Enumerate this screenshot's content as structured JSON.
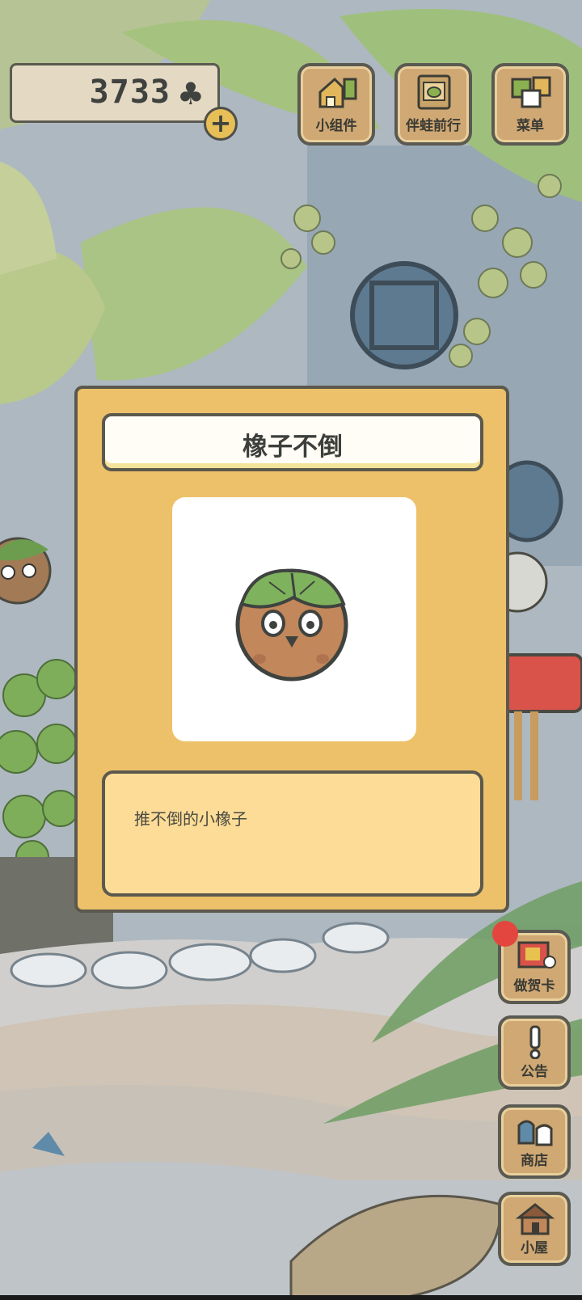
{
  "currency": {
    "count": "3733",
    "icon": "clover-icon",
    "add_icon": "plus-icon"
  },
  "top_buttons": {
    "widgets": {
      "label": "小组件",
      "icon": "widget-house-icon"
    },
    "frog_progress": {
      "label": "伴蛙前行",
      "icon": "frog-book-icon"
    },
    "menu": {
      "label": "菜单",
      "icon": "menu-cards-icon"
    }
  },
  "dialog": {
    "title": "橡子不倒",
    "item_icon": "acorn-owl-icon",
    "description": "推不倒的小橡子"
  },
  "side_buttons": {
    "greeting_card": {
      "label": "做贺卡",
      "icon": "greeting-card-icon",
      "badge": true
    },
    "notice": {
      "label": "公告",
      "icon": "exclamation-icon"
    },
    "shop": {
      "label": "商店",
      "icon": "shop-bags-icon"
    },
    "house": {
      "label": "小屋",
      "icon": "house-icon"
    }
  },
  "colors": {
    "dialog_bg": "#edc16a",
    "desc_bg": "#fddc97",
    "button_wood": "#cfa874",
    "badge_red": "#e2463f"
  }
}
